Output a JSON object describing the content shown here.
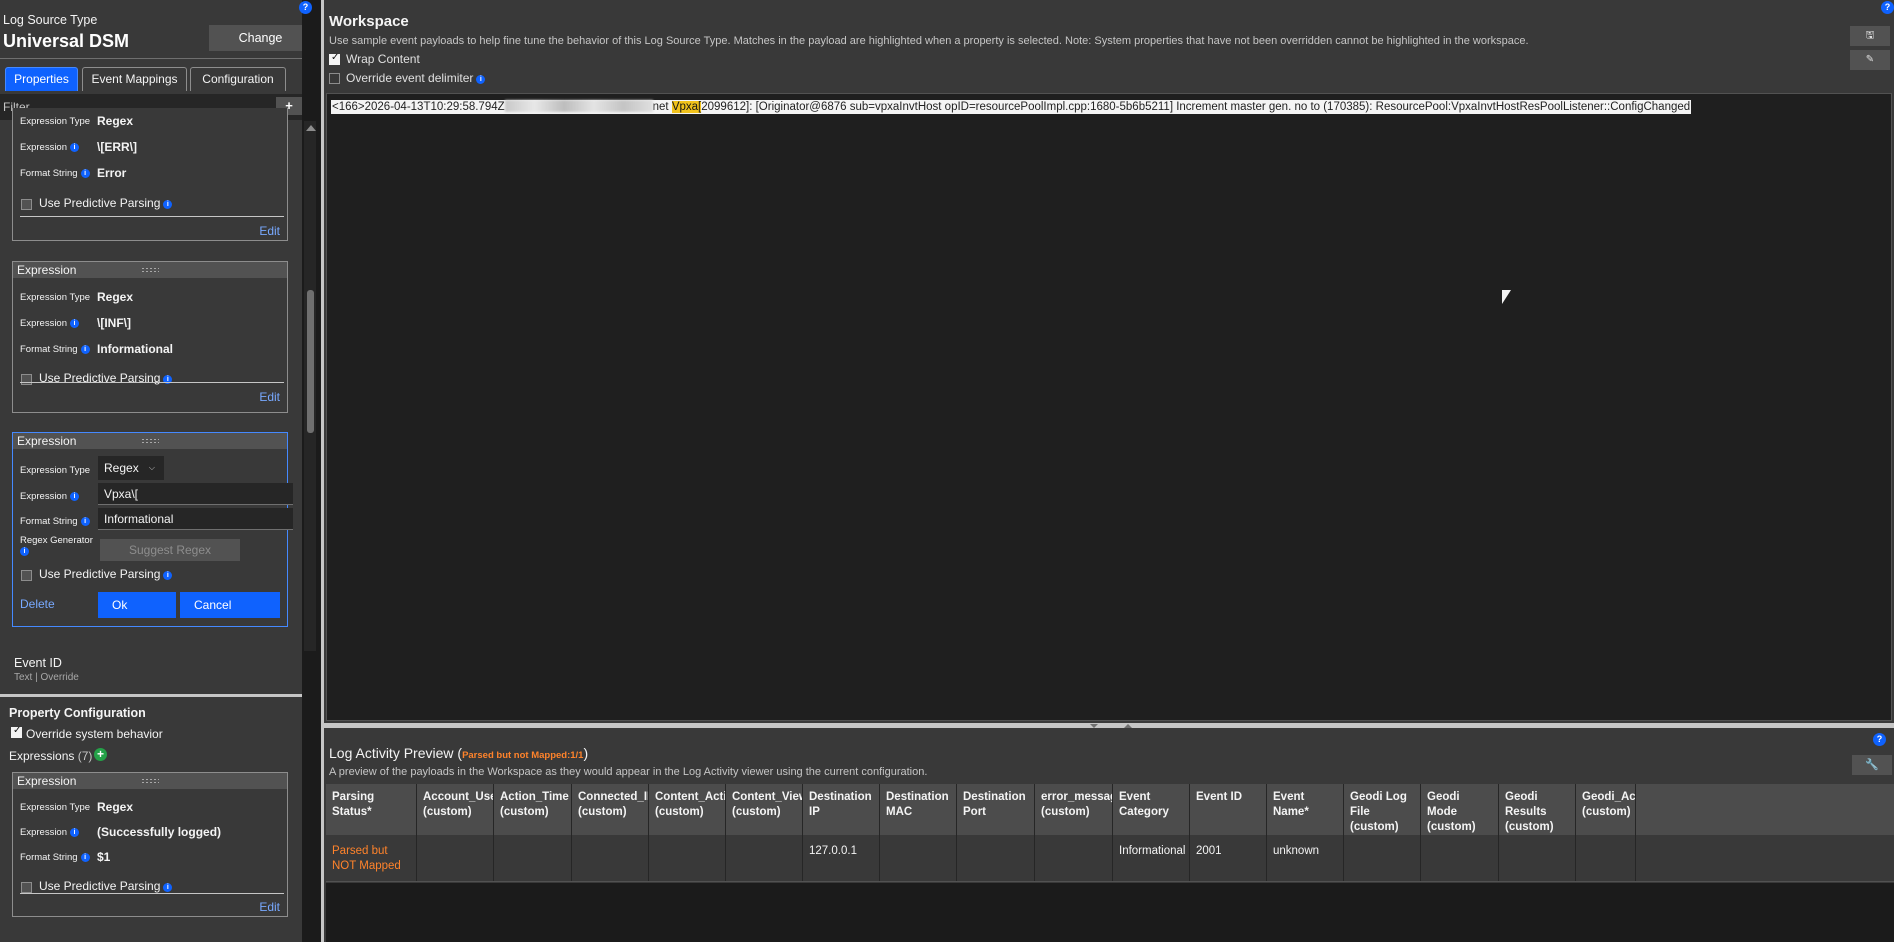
{
  "left_panel": {
    "log_source_type_label": "Log Source Type",
    "log_source_type_name": "Universal DSM",
    "change_label": "Change",
    "help": "?",
    "tabs": [
      {
        "label": "Properties",
        "active": true
      },
      {
        "label": "Event Mappings",
        "active": false
      },
      {
        "label": "Configuration",
        "active": false
      }
    ],
    "filter_placeholder": "Filter",
    "add_label": "+",
    "expressions": [
      {
        "header": "",
        "type_label": "Expression Type",
        "type_value": "Regex",
        "expression_label": "Expression",
        "expression_value": "\\[ERR\\]",
        "format_label": "Format String",
        "format_value": "Error",
        "predictive_label": "Use Predictive Parsing",
        "edit_label": "Edit"
      },
      {
        "header": "Expression",
        "type_label": "Expression Type",
        "type_value": "Regex",
        "expression_label": "Expression",
        "expression_value": "\\[INF\\]",
        "format_label": "Format String",
        "format_value": "Informational",
        "predictive_label": "Use Predictive Parsing",
        "edit_label": "Edit"
      }
    ],
    "editing_expression": {
      "header": "Expression",
      "type_label": "Expression Type",
      "type_value": "Regex",
      "expression_label": "Expression",
      "expression_value": "Vpxa\\[",
      "format_label": "Format String",
      "format_value": "Informational",
      "regex_gen_label": "Regex Generator",
      "suggest_label": "Suggest Regex",
      "predictive_label": "Use Predictive Parsing",
      "delete_label": "Delete",
      "ok_label": "Ok",
      "cancel_label": "Cancel"
    },
    "event_id": {
      "name": "Event ID",
      "sub": "Text | Override"
    },
    "property_config": {
      "title": "Property Configuration",
      "override_label": "Override system behavior",
      "override_checked": true,
      "expressions_label": "Expressions",
      "expressions_count": "(7)"
    },
    "bottom_expression": {
      "header": "Expression",
      "type_label": "Expression Type",
      "type_value": "Regex",
      "expression_label": "Expression",
      "expression_value": "(Successfully logged)",
      "format_label": "Format String",
      "format_value": "$1",
      "predictive_label": "Use Predictive Parsing",
      "edit_label": "Edit"
    }
  },
  "workspace": {
    "title": "Workspace",
    "description": "Use sample event payloads to help fine tune the behavior of this Log Source Type. Matches in the payload are highlighted when a property is selected. Note: System properties that have not been overridden cannot be highlighted in the workspace.",
    "wrap_label": "Wrap Content",
    "wrap_checked": true,
    "override_delim_label": "Override event delimiter",
    "override_delim_checked": false,
    "payload_before": "<166>2026-04-13T10:29:58.794Z",
    "payload_mid": "net ",
    "payload_highlight": "Vpxa[",
    "payload_after": "2099612]: [Originator@6876 sub=vpxaInvtHost opID=resourcePoolImpl.cpp:1680-5b6b5211] Increment master gen. no to (170385): ResourcePool:VpxaInvtHostResPoolListener::ConfigChanged"
  },
  "log_activity_preview": {
    "title": "Log Activity Preview (",
    "badge": "Parsed but not Mapped:1/1",
    "title_close": ")",
    "description": "A preview of the payloads in the Workspace as they would appear in the Log Activity viewer using the current configuration.",
    "columns": [
      "Parsing Status*",
      "Account_Userna (custom)",
      "Action_Time (custom)",
      "Connected_IP (custom)",
      "Content_Action (custom)",
      "Content_View (custom)",
      "Destination IP",
      "Destination MAC",
      "Destination Port",
      "error_message (custom)",
      "Event Category",
      "Event ID",
      "Event Name*",
      "Geodi Log File (custom)",
      "Geodi Mode (custom)",
      "Geodi Results (custom)",
      "Geodi_Acti (custom)"
    ],
    "row": [
      "Parsed but NOT Mapped",
      "",
      "",
      "",
      "",
      "",
      "127.0.0.1",
      "",
      "",
      "",
      "Informational",
      "2001",
      "unknown",
      "",
      "",
      "",
      ""
    ]
  },
  "colors": {
    "accent": "#0f62fe",
    "warning": "#ff832b",
    "highlight": "#f1c21b"
  }
}
